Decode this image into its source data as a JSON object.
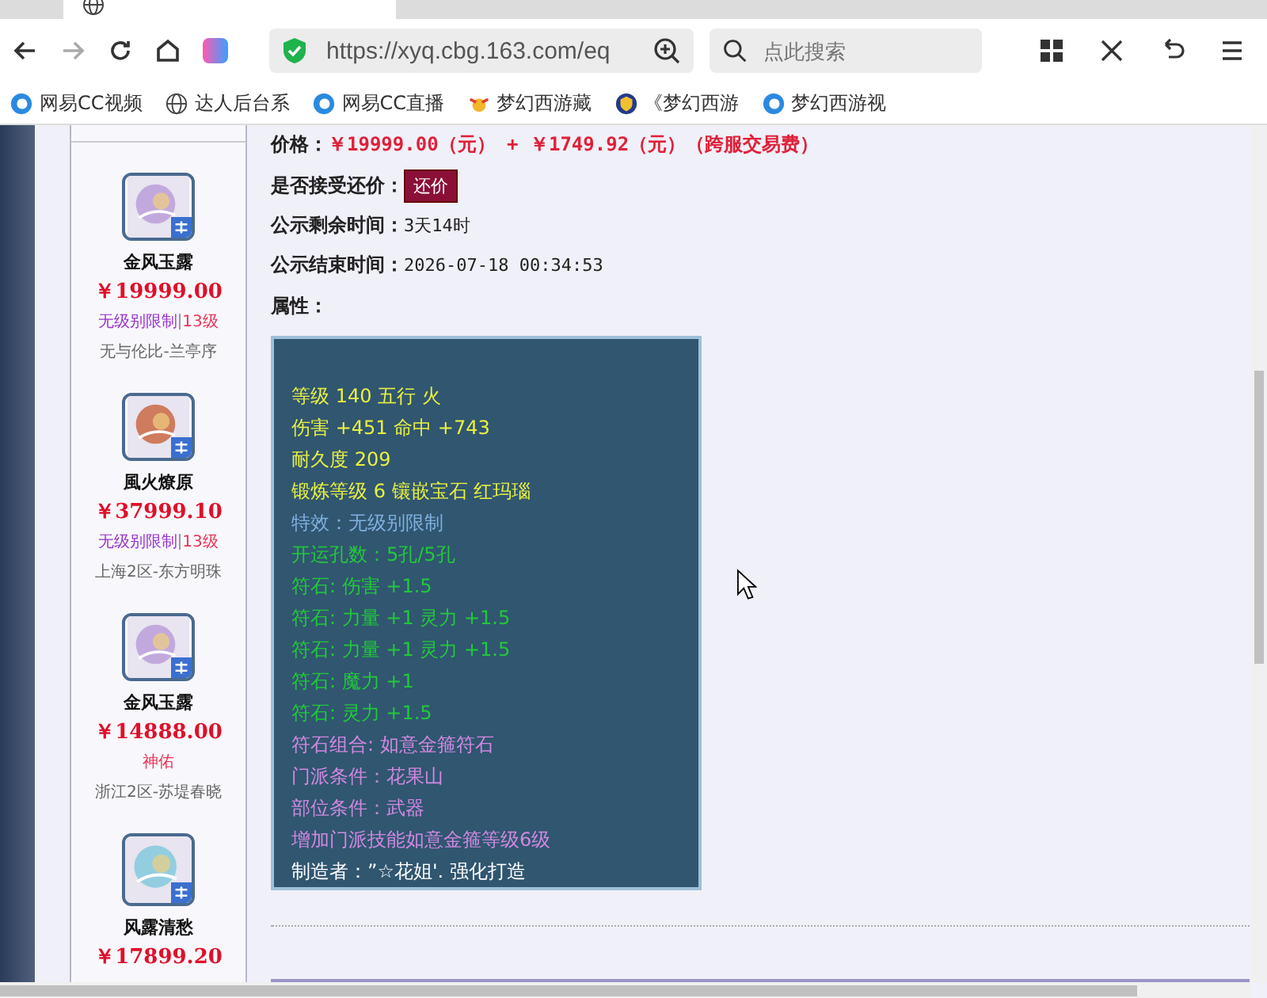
{
  "browser": {
    "url": "https://xyq.cbg.163.com/eq",
    "search_placeholder": "点此搜索",
    "bookmarks": [
      {
        "label": "网易CC视频",
        "kind": "cc"
      },
      {
        "label": "达人后台系",
        "kind": "globe"
      },
      {
        "label": "网易CC直播",
        "kind": "cc"
      },
      {
        "label": "梦幻西游藏",
        "kind": "sun"
      },
      {
        "label": "《梦幻西游",
        "kind": "shield"
      },
      {
        "label": "梦幻西游视",
        "kind": "cc"
      }
    ]
  },
  "sidebar": {
    "items": [
      {
        "name": "金风玉露",
        "price": "￥19999.00",
        "kind": "jade",
        "tags": [
          {
            "text": "无级别限制",
            "color": "#9933cc"
          },
          {
            "text": "13级",
            "color": "#ee3355"
          }
        ],
        "server": "无与伦比-兰亭序"
      },
      {
        "name": "風火燎原",
        "price": "￥37999.10",
        "kind": "fire",
        "tags": [
          {
            "text": "无级别限制",
            "color": "#9933cc"
          },
          {
            "text": "13级",
            "color": "#ee3355"
          }
        ],
        "server": "上海2区-东方明珠"
      },
      {
        "name": "金风玉露",
        "price": "￥14888.00",
        "kind": "jade",
        "tags": [
          {
            "text": "神佑",
            "color": "#ee3355"
          }
        ],
        "server": "浙江2区-苏堤春晓"
      },
      {
        "name": "风露清愁",
        "price": "￥17899.20",
        "kind": "ice"
      }
    ]
  },
  "detail": {
    "price_label": "价格：",
    "price": "￥19999.00（元） +  ￥1749.92（元）（跨服交易费）",
    "bargain_label": "是否接受还价：",
    "bargain_button": "还价",
    "remaining_label": "公示剩余时间：",
    "remaining": "3天14时",
    "end_label": "公示结束时间：",
    "end": "2026-07-18 00:34:53",
    "attributes_label": "属性：",
    "stats": [
      {
        "text": "等级 140 五行 火",
        "kind": "base"
      },
      {
        "text": "伤害 +451 命中 +743",
        "kind": "base"
      },
      {
        "text": "耐久度 209",
        "kind": "base"
      },
      {
        "text": "锻炼等级 6 镶嵌宝石 红玛瑙",
        "kind": "base"
      },
      {
        "text": "特效：无级别限制",
        "kind": "effect"
      },
      {
        "text": "开运孔数：5孔/5孔",
        "kind": "rune"
      },
      {
        "text": "符石: 伤害 +1.5",
        "kind": "rune"
      },
      {
        "text": "符石: 力量 +1 灵力 +1.5",
        "kind": "rune"
      },
      {
        "text": "符石: 力量 +1 灵力 +1.5",
        "kind": "rune"
      },
      {
        "text": "符石: 魔力 +1",
        "kind": "rune"
      },
      {
        "text": "符石: 灵力 +1.5",
        "kind": "rune"
      },
      {
        "text": "符石组合: 如意金箍符石",
        "kind": "combo"
      },
      {
        "text": "门派条件：花果山",
        "kind": "combo"
      },
      {
        "text": "部位条件：武器",
        "kind": "combo"
      },
      {
        "text": "增加门派技能如意金箍等级6级",
        "kind": "combo"
      },
      {
        "text": "制造者：”☆花姐'. 强化打造",
        "kind": "maker"
      }
    ]
  }
}
